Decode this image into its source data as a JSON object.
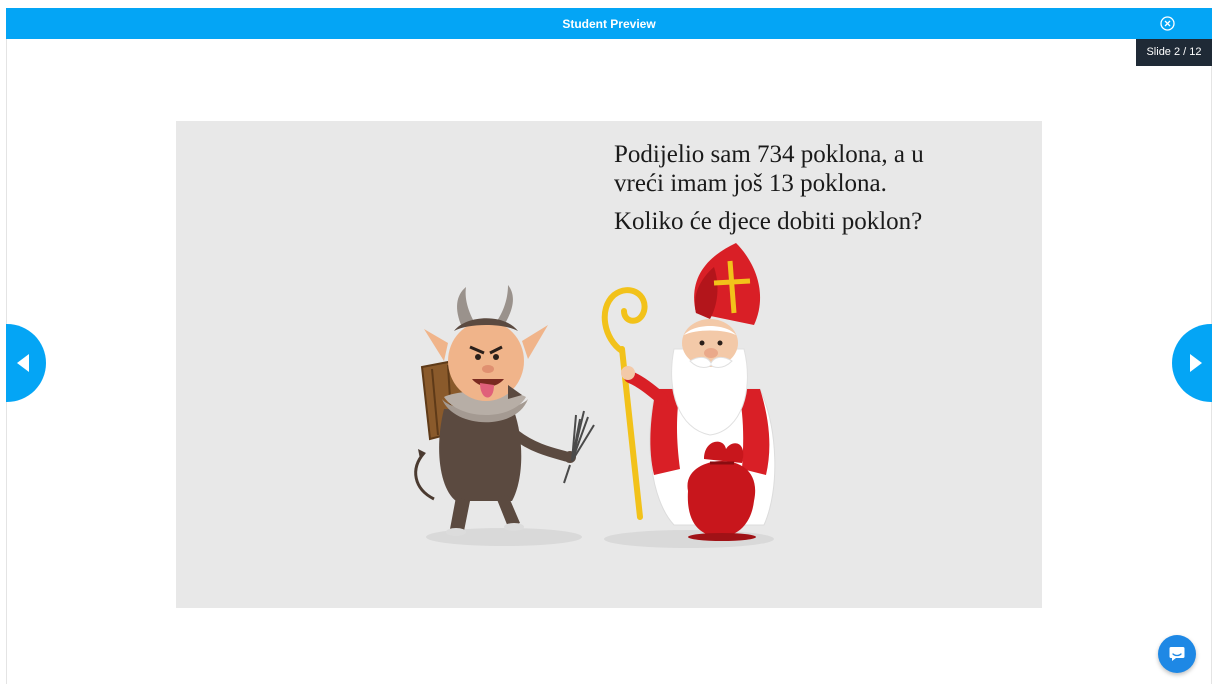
{
  "header": {
    "title": "Student Preview"
  },
  "slide_counter": {
    "label": "Slide 2 / 12",
    "current": 2,
    "total": 12
  },
  "slide": {
    "line1": "Podijelio sam 734 poklona, a u",
    "line2": "vreći imam još 13 poklona.",
    "line3": "Koliko će djece dobiti poklon?"
  },
  "icons": {
    "close": "close-circle-icon",
    "prev": "triangle-left-icon",
    "next": "triangle-right-icon",
    "chat": "chat-bubble-icon"
  },
  "colors": {
    "accent": "#04a5f5",
    "counter_bg": "#1f2a36",
    "slide_bg": "#e8e8e8",
    "chat": "#1e88e5"
  }
}
